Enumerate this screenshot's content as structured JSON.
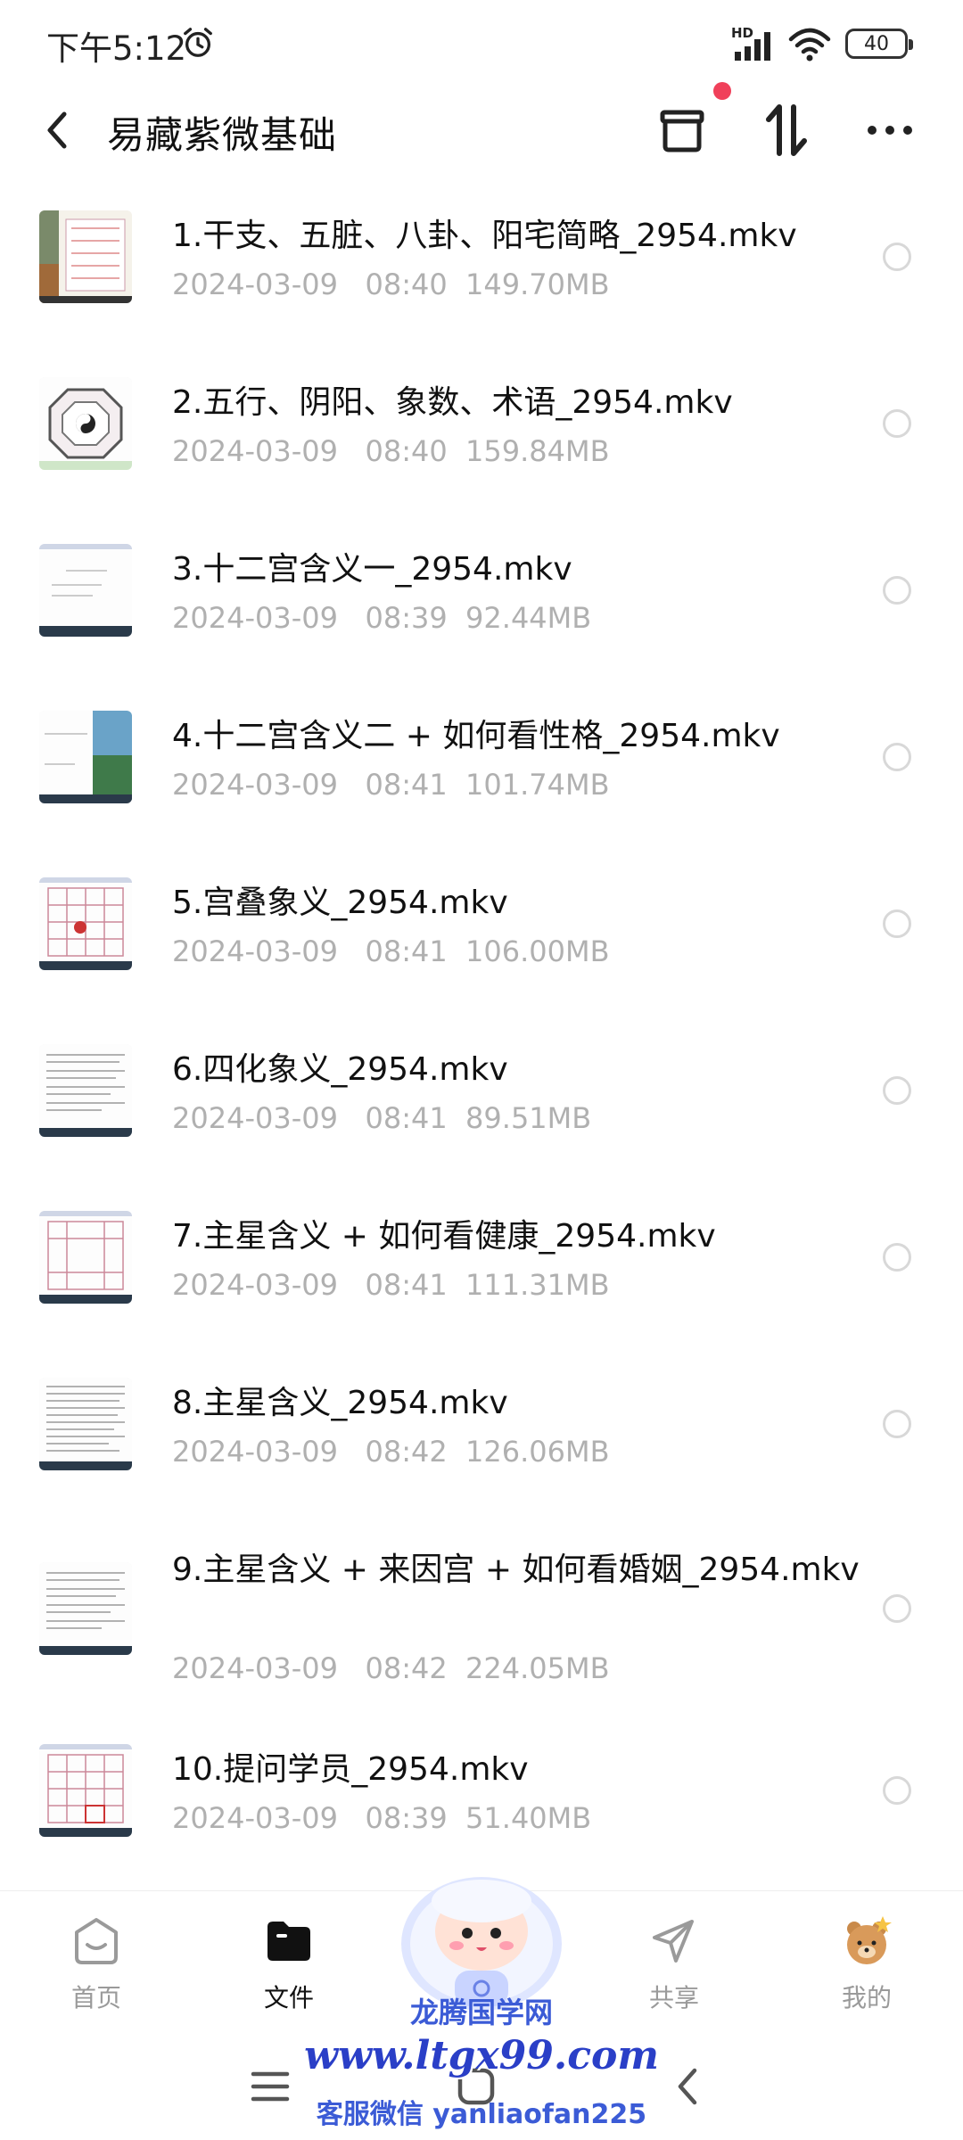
{
  "status_bar": {
    "time": "下午5:12",
    "network_label": "HD",
    "battery": "40"
  },
  "header": {
    "title": "易藏紫微基础"
  },
  "files": [
    {
      "name": "1.干支、五脏、八卦、阳宅简略_2954.mkv",
      "date": "2024-03-09",
      "time": "08:40",
      "size": "149.70MB"
    },
    {
      "name": "2.五行、阴阳、象数、术语_2954.mkv",
      "date": "2024-03-09",
      "time": "08:40",
      "size": "159.84MB"
    },
    {
      "name": "3.十二宫含义一_2954.mkv",
      "date": "2024-03-09",
      "time": "08:39",
      "size": "92.44MB"
    },
    {
      "name": "4.十二宫含义二 + 如何看性格_2954.mkv",
      "date": "2024-03-09",
      "time": "08:41",
      "size": "101.74MB"
    },
    {
      "name": "5.宫叠象义_2954.mkv",
      "date": "2024-03-09",
      "time": "08:41",
      "size": "106.00MB"
    },
    {
      "name": "6.四化象义_2954.mkv",
      "date": "2024-03-09",
      "time": "08:41",
      "size": "89.51MB"
    },
    {
      "name": "7.主星含义 + 如何看健康_2954.mkv",
      "date": "2024-03-09",
      "time": "08:41",
      "size": "111.31MB"
    },
    {
      "name": "8.主星含义_2954.mkv",
      "date": "2024-03-09",
      "time": "08:42",
      "size": "126.06MB"
    },
    {
      "name": "9.主星含义 + 来因宫 + 如何看婚姻_2954.mkv",
      "date": "2024-03-09",
      "time": "08:42",
      "size": "224.05MB"
    },
    {
      "name": "10.提问学员_2954.mkv",
      "date": "2024-03-09",
      "time": "08:39",
      "size": "51.40MB"
    }
  ],
  "bottom_nav": {
    "home": "首页",
    "files": "文件",
    "share": "共享",
    "me": "我的"
  },
  "watermark": {
    "site_name": "龙腾国学网",
    "url": "www.ltgx99.com",
    "contact": "客服微信 yanliaofan225"
  },
  "colors": {
    "accent_red": "#f0405a",
    "meta_gray": "#b0b0b0",
    "watermark_blue": "#2a3fc7"
  }
}
